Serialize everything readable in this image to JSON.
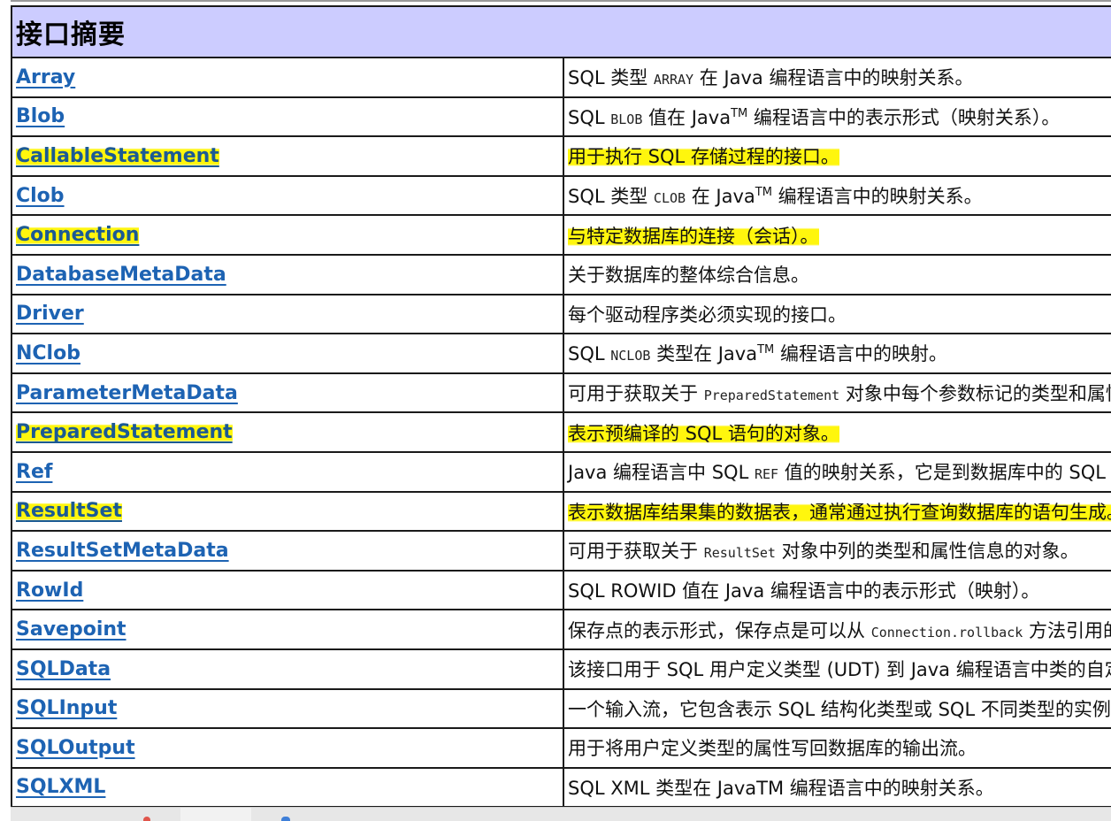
{
  "caption": "接口摘要",
  "rows": [
    {
      "name": "Array",
      "pre": "SQL 类型 ",
      "code": "ARRAY",
      "post": " 在 Java 编程语言中的映射关系。",
      "highlighted": false
    },
    {
      "name": "Blob",
      "pre": "SQL ",
      "code": "BLOB",
      "post": " 值在 Java",
      "tm": "TM",
      "post2": " 编程语言中的表示形式（映射关系）。",
      "highlighted": false
    },
    {
      "name": "CallableStatement",
      "pre": "用于执行 SQL 存储过程的接口。",
      "highlighted": true
    },
    {
      "name": "Clob",
      "pre": "SQL 类型 ",
      "code": "CLOB",
      "post": " 在 Java",
      "tm": "TM",
      "post2": " 编程语言中的映射关系。",
      "highlighted": false
    },
    {
      "name": "Connection",
      "pre": "与特定数据库的连接（会话）。",
      "highlighted": true
    },
    {
      "name": "DatabaseMetaData",
      "pre": "关于数据库的整体综合信息。",
      "highlighted": false
    },
    {
      "name": "Driver",
      "pre": "每个驱动程序类必须实现的接口。",
      "highlighted": false
    },
    {
      "name": "NClob",
      "pre": "SQL ",
      "code": "NCLOB",
      "post": " 类型在 Java",
      "tm": "TM",
      "post2": " 编程语言中的映射。",
      "highlighted": false
    },
    {
      "name": "ParameterMetaData",
      "pre": "可用于获取关于 ",
      "code": "PreparedStatement",
      "post": " 对象中每个参数标记的类型和属性信息的对象。",
      "highlighted": false
    },
    {
      "name": "PreparedStatement",
      "pre": "表示预编译的 SQL 语句的对象。",
      "highlighted": true
    },
    {
      "name": "Ref",
      "pre": "Java 编程语言中 SQL ",
      "code": "REF",
      "post": " 值的映射关系，它是到数据库中的 SQL 结构类型值的引用。",
      "highlighted": false
    },
    {
      "name": "ResultSet",
      "pre": "表示数据库结果集的数据表，通常通过执行查询数据库的语句生成。",
      "highlighted": true
    },
    {
      "name": "ResultSetMetaData",
      "pre": "可用于获取关于 ",
      "code": "ResultSet",
      "post": " 对象中列的类型和属性信息的对象。",
      "highlighted": false
    },
    {
      "name": "RowId",
      "pre": "SQL ROWID 值在 Java 编程语言中的表示形式（映射）。",
      "highlighted": false
    },
    {
      "name": "Savepoint",
      "pre": "保存点的表示形式，保存点是可以从 ",
      "code": "Connection.rollback",
      "post": " 方法引用的当前事务中的点。",
      "highlighted": false
    },
    {
      "name": "SQLData",
      "pre": "该接口用于 SQL 用户定义类型 (UDT) 到 Java 编程语言中类的自定义映射关系。",
      "highlighted": false
    },
    {
      "name": "SQLInput",
      "pre": "一个输入流，它包含表示 SQL 结构化类型或 SQL 不同类型的实例的值组成的流。",
      "highlighted": false
    },
    {
      "name": "SQLOutput",
      "pre": "用于将用户定义类型的属性写回数据库的输出流。",
      "highlighted": false
    },
    {
      "name": "SQLXML",
      "pre": "SQL XML 类型在 JavaTM 编程语言中的映射关系。",
      "highlighted": false
    }
  ],
  "colors": {
    "caption_bg": "#ccccff",
    "link": "#1d63b3",
    "highlight": "#fff500"
  }
}
